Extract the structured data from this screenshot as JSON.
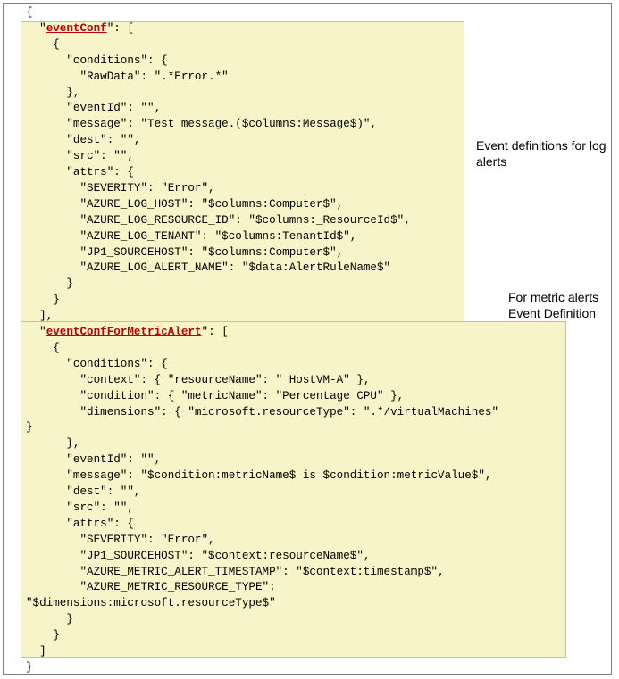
{
  "annotations": {
    "log_alerts": "Event definitions for log alerts",
    "metric_alerts": "For metric alerts Event Definition"
  },
  "code_lines": [
    {
      "pre": "{",
      "key": "",
      "post": ""
    },
    {
      "pre": "  \"",
      "key": "eventConf",
      "post": "\": ["
    },
    {
      "pre": "    {",
      "key": "",
      "post": ""
    },
    {
      "pre": "      \"conditions\": {",
      "key": "",
      "post": ""
    },
    {
      "pre": "        \"RawData\": \".*Error.*\"",
      "key": "",
      "post": ""
    },
    {
      "pre": "      },",
      "key": "",
      "post": ""
    },
    {
      "pre": "      \"eventId\": \"\",",
      "key": "",
      "post": ""
    },
    {
      "pre": "      \"message\": \"Test message.($columns:Message$)\",",
      "key": "",
      "post": ""
    },
    {
      "pre": "      \"dest\": \"\",",
      "key": "",
      "post": ""
    },
    {
      "pre": "      \"src\": \"\",",
      "key": "",
      "post": ""
    },
    {
      "pre": "      \"attrs\": {",
      "key": "",
      "post": ""
    },
    {
      "pre": "        \"SEVERITY\": \"Error\",",
      "key": "",
      "post": ""
    },
    {
      "pre": "        \"AZURE_LOG_HOST\": \"$columns:Computer$\",",
      "key": "",
      "post": ""
    },
    {
      "pre": "        \"AZURE_LOG_RESOURCE_ID\": \"$columns:_ResourceId$\",",
      "key": "",
      "post": ""
    },
    {
      "pre": "        \"AZURE_LOG_TENANT\": \"$columns:TenantId$\",",
      "key": "",
      "post": ""
    },
    {
      "pre": "        \"JP1_SOURCEHOST\": \"$columns:Computer$\",",
      "key": "",
      "post": ""
    },
    {
      "pre": "        \"AZURE_LOG_ALERT_NAME\": \"$data:AlertRuleName$\"",
      "key": "",
      "post": ""
    },
    {
      "pre": "      }",
      "key": "",
      "post": ""
    },
    {
      "pre": "    }",
      "key": "",
      "post": ""
    },
    {
      "pre": "  ],",
      "key": "",
      "post": ""
    },
    {
      "pre": "  \"",
      "key": "eventConfForMetricAlert",
      "post": "\": ["
    },
    {
      "pre": "    {",
      "key": "",
      "post": ""
    },
    {
      "pre": "      \"conditions\": {",
      "key": "",
      "post": ""
    },
    {
      "pre": "        \"context\": { \"resourceName\": \" HostVM-A\" },",
      "key": "",
      "post": ""
    },
    {
      "pre": "        \"condition\": { \"metricName\": \"Percentage CPU\" },",
      "key": "",
      "post": ""
    },
    {
      "pre": "        \"dimensions\": { \"microsoft.resourceType\": \".*/virtualMachines\"",
      "key": "",
      "post": ""
    },
    {
      "pre": "}",
      "key": "",
      "post": ""
    },
    {
      "pre": "      },",
      "key": "",
      "post": ""
    },
    {
      "pre": "      \"eventId\": \"\",",
      "key": "",
      "post": ""
    },
    {
      "pre": "      \"message\": \"$condition:metricName$ is $condition:metricValue$\",",
      "key": "",
      "post": ""
    },
    {
      "pre": "      \"dest\": \"\",",
      "key": "",
      "post": ""
    },
    {
      "pre": "      \"src\": \"\",",
      "key": "",
      "post": ""
    },
    {
      "pre": "      \"attrs\": {",
      "key": "",
      "post": ""
    },
    {
      "pre": "        \"SEVERITY\": \"Error\",",
      "key": "",
      "post": ""
    },
    {
      "pre": "        \"JP1_SOURCEHOST\": \"$context:resourceName$\",",
      "key": "",
      "post": ""
    },
    {
      "pre": "        \"AZURE_METRIC_ALERT_TIMESTAMP\": \"$context:timestamp$\",",
      "key": "",
      "post": ""
    },
    {
      "pre": "        \"AZURE_METRIC_RESOURCE_TYPE\":",
      "key": "",
      "post": ""
    },
    {
      "pre": "\"$dimensions:microsoft.resourceType$\"",
      "key": "",
      "post": ""
    },
    {
      "pre": "      }",
      "key": "",
      "post": ""
    },
    {
      "pre": "    }",
      "key": "",
      "post": ""
    },
    {
      "pre": "  ]",
      "key": "",
      "post": ""
    },
    {
      "pre": "}",
      "key": "",
      "post": ""
    }
  ]
}
